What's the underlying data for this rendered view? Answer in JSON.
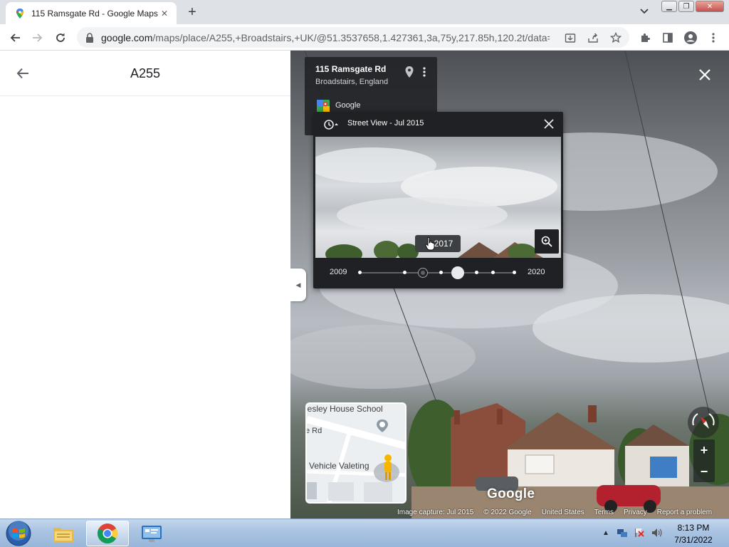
{
  "browser": {
    "tab_title": "115 Ramsgate Rd - Google Maps",
    "new_tab": "+",
    "url_host": "google.com",
    "url_rest": "/maps/place/A255,+Broadstairs,+UK/@51.3537658,1.427361,3a,75y,217.85h,120.2t/data=!..."
  },
  "left_panel": {
    "title": "A255"
  },
  "street_view": {
    "address_card": {
      "street": "115 Ramsgate Rd",
      "locality": "Broadstairs, England",
      "provider": "Google"
    },
    "time_machine": {
      "title": "Street View - Jul 2015",
      "tooltip_year": "2017",
      "start_year": "2009",
      "end_year": "2020"
    },
    "minimap": {
      "labels": [
        "lesley House School",
        "e Rd",
        "Vehicle Valeting"
      ]
    },
    "zoom_in": "+",
    "zoom_out": "−",
    "logo": "Google",
    "footer": {
      "capture": "Image capture: Jul 2015",
      "copyright": "© 2022 Google",
      "country": "United States",
      "terms": "Terms",
      "privacy": "Privacy",
      "report": "Report a problem"
    }
  },
  "taskbar": {
    "time": "8:13 PM",
    "date": "7/31/2022"
  },
  "colors": {
    "maps_panel_dark": "#202124",
    "taskbar": "#a9c3e2",
    "compass_red": "#d93025"
  },
  "icons": [
    "maps-favicon",
    "back-arrow-icon",
    "reload-icon",
    "lock-icon",
    "install-icon",
    "share-icon",
    "star-icon",
    "extensions-icon",
    "sidepanel-icon",
    "profile-icon",
    "menu-icon",
    "close-icon",
    "pin-icon",
    "more-vert-icon",
    "history-clock-icon",
    "zoom-icon",
    "hand-cursor-icon",
    "compass-icon",
    "windows-start-icon",
    "explorer-icon",
    "chrome-icon",
    "control-panel-icon"
  ]
}
